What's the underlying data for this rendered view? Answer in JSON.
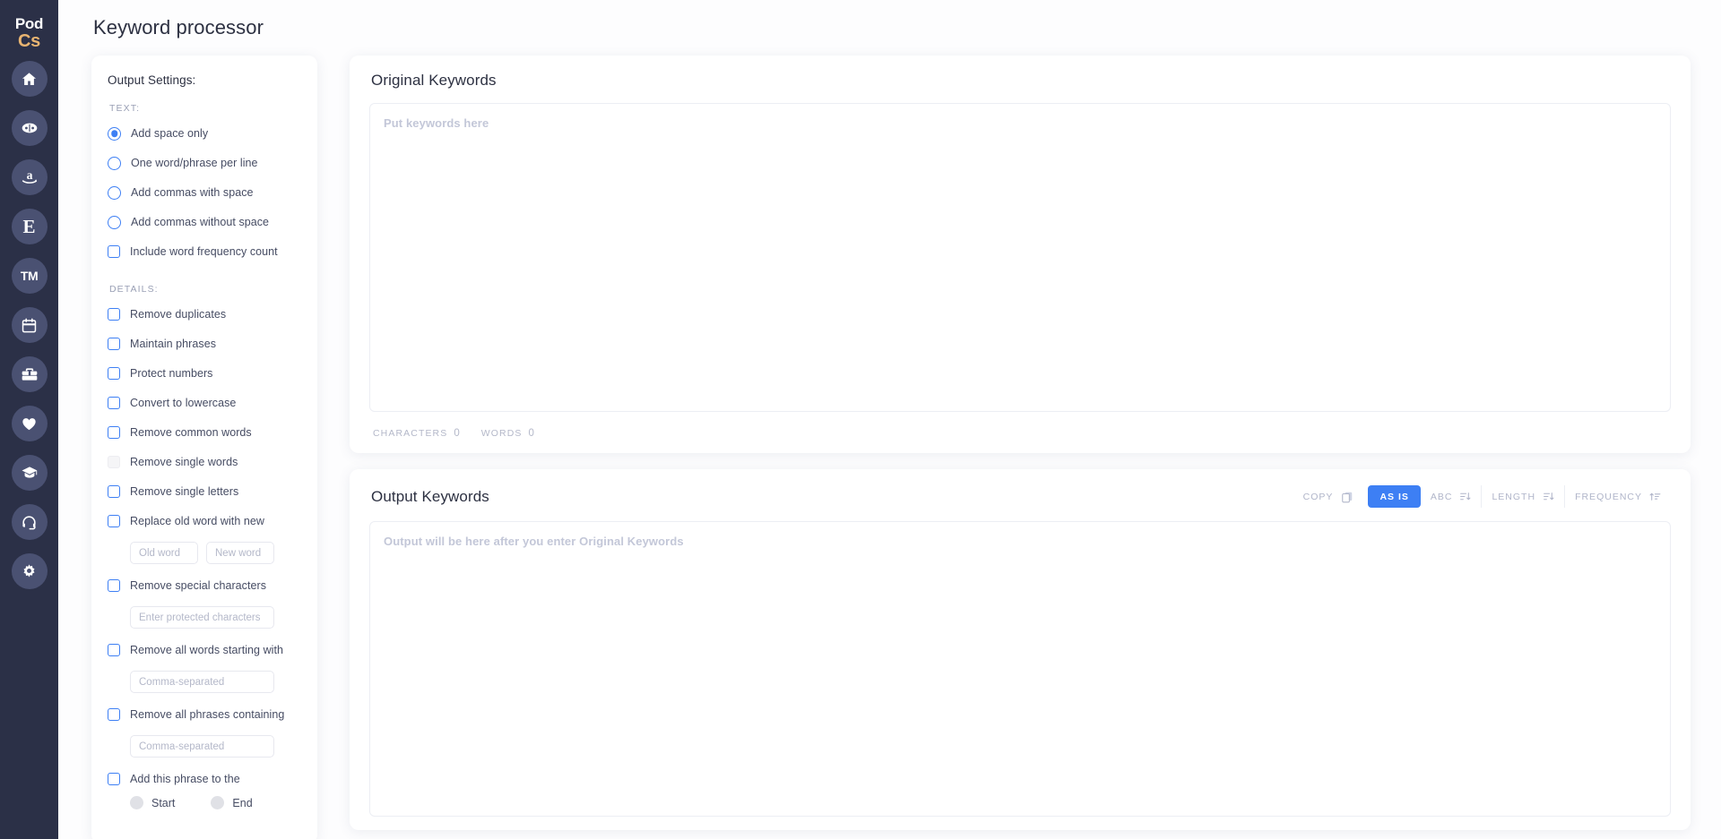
{
  "app": {
    "logo_line1": "Pod",
    "logo_line2": "Cs",
    "accent_blue": "#3d7ff4",
    "sidebar_bg": "#2b3047",
    "logo_gold": "#e8b471"
  },
  "sidebar": {
    "items": [
      {
        "name": "home-icon",
        "label": "Home"
      },
      {
        "name": "book-icon",
        "label": "Book"
      },
      {
        "name": "amazon-icon",
        "label": "Amazon"
      },
      {
        "name": "etsy-icon",
        "label": "Etsy"
      },
      {
        "name": "trademark-icon",
        "label": "TM"
      },
      {
        "name": "calendar-icon",
        "label": "Calendar"
      },
      {
        "name": "toolbox-icon",
        "label": "Tools"
      },
      {
        "name": "heart-icon",
        "label": "Favorites"
      },
      {
        "name": "graduation-cap-icon",
        "label": "Academy"
      },
      {
        "name": "headset-icon",
        "label": "Support"
      },
      {
        "name": "gear-icon",
        "label": "Settings"
      }
    ]
  },
  "page": {
    "title": "Keyword processor"
  },
  "settings": {
    "heading": "Output Settings:",
    "text_group_label": "TEXT:",
    "details_group_label": "DETAILS:",
    "text_options": [
      {
        "label": "Add space only",
        "checked": true
      },
      {
        "label": "One word/phrase per line",
        "checked": false
      },
      {
        "label": "Add commas with space",
        "checked": false
      },
      {
        "label": "Add commas without space",
        "checked": false
      }
    ],
    "frequency_option": {
      "label": "Include word frequency count",
      "checked": false
    },
    "details": [
      {
        "label": "Remove duplicates",
        "checked": false,
        "disabled": false
      },
      {
        "label": "Maintain phrases",
        "checked": false,
        "disabled": false
      },
      {
        "label": "Protect numbers",
        "checked": false,
        "disabled": false
      },
      {
        "label": "Convert to lowercase",
        "checked": false,
        "disabled": false
      },
      {
        "label": "Remove common words",
        "checked": false,
        "disabled": false
      },
      {
        "label": "Remove single words",
        "checked": false,
        "disabled": true
      },
      {
        "label": "Remove single letters",
        "checked": false,
        "disabled": false
      }
    ],
    "replace": {
      "label": "Replace old word with new",
      "old_placeholder": "Old word",
      "old_value": "",
      "new_placeholder": "New word",
      "new_value": ""
    },
    "special_chars": {
      "label": "Remove special characters",
      "placeholder": "Enter protected characters",
      "value": ""
    },
    "words_starting": {
      "label": "Remove all words starting with",
      "placeholder": "Comma-separated",
      "value": ""
    },
    "phrases_containing": {
      "label": "Remove all phrases containing",
      "placeholder": "Comma-separated",
      "value": ""
    },
    "add_phrase": {
      "label": "Add this phrase to the",
      "start_label": "Start",
      "end_label": "End"
    }
  },
  "original": {
    "title": "Original Keywords",
    "placeholder": "Put keywords here",
    "value": "",
    "characters_label": "CHARACTERS",
    "characters_value": "0",
    "words_label": "WORDS",
    "words_value": "0"
  },
  "output": {
    "title": "Output Keywords",
    "placeholder": "Output will be here after you enter Original Keywords",
    "value": "",
    "copy_label": "COPY",
    "sort_buttons": [
      {
        "label": "AS IS",
        "active": true,
        "icon": "none"
      },
      {
        "label": "ABC",
        "active": false,
        "icon": "sort-desc-icon"
      },
      {
        "label": "LENGTH",
        "active": false,
        "icon": "sort-desc-icon"
      },
      {
        "label": "FREQUENCY",
        "active": false,
        "icon": "sort-asc-icon"
      }
    ]
  }
}
